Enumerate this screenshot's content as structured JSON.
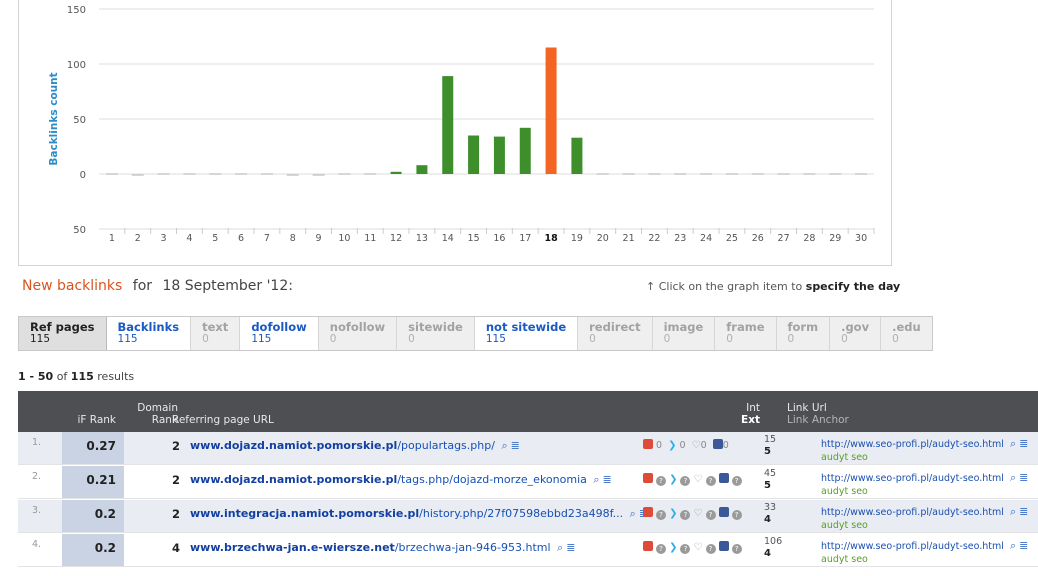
{
  "chart_data": {
    "type": "bar",
    "ylabel": "Backlinks count",
    "y_ticks": [
      "150",
      "100",
      "50",
      "0",
      "50"
    ],
    "categories": [
      "1",
      "2",
      "3",
      "4",
      "5",
      "6",
      "7",
      "8",
      "9",
      "10",
      "11",
      "12",
      "13",
      "14",
      "15",
      "16",
      "17",
      "18",
      "19",
      "20",
      "21",
      "22",
      "23",
      "24",
      "25",
      "26",
      "27",
      "28",
      "29",
      "30"
    ],
    "values": [
      0,
      -1,
      0,
      0,
      0,
      0,
      0,
      -1,
      -1,
      0,
      0,
      2,
      8,
      89,
      35,
      34,
      42,
      115,
      33,
      0,
      0,
      0,
      0,
      0,
      0,
      0,
      0,
      0,
      0,
      0
    ],
    "highlight_category": "18",
    "colors": {
      "default": "#3e8f2c",
      "highlight": "#f26522",
      "zero": "#c8c8c8"
    },
    "grid": true
  },
  "new_backlinks": {
    "link_label": "New backlinks",
    "for_label": "for",
    "date": "18 September '12:"
  },
  "hint": {
    "prefix": "↑ Click on the graph item to",
    "bold": "specify the day"
  },
  "tabs": [
    {
      "label": "Ref pages",
      "count": "115"
    },
    {
      "label": "Backlinks",
      "count": "115"
    },
    {
      "label": "text",
      "count": "0"
    },
    {
      "label": "dofollow",
      "count": "115"
    },
    {
      "label": "nofollow",
      "count": "0"
    },
    {
      "label": "sitewide",
      "count": "0"
    },
    {
      "label": "not sitewide",
      "count": "115"
    },
    {
      "label": "redirect",
      "count": "0"
    },
    {
      "label": "image",
      "count": "0"
    },
    {
      "label": "frame",
      "count": "0"
    },
    {
      "label": "form",
      "count": "0"
    },
    {
      "label": ".gov",
      "count": "0"
    },
    {
      "label": ".edu",
      "count": "0"
    }
  ],
  "results": {
    "range": "1 - 50",
    "of": "of",
    "total": "115",
    "suffix": "results"
  },
  "table": {
    "headers": {
      "rank": "iF Rank",
      "domain_rank_1": "Domain",
      "domain_rank_2": "Rank",
      "url": "Referring page URL",
      "int": "Int",
      "ext": "Ext",
      "link_url": "Link Url",
      "link_anchor": "Link Anchor"
    },
    "rows": [
      {
        "num": "1.",
        "rank": "0.27",
        "domain_rank": "2",
        "url_domain": "www.dojazd.namiot.pomorskie.pl",
        "url_path": "/populartags.php/",
        "social": {
          "g": "0",
          "t": "0",
          "l": "0",
          "f": "0"
        },
        "int": "15",
        "ext": "5",
        "link_url": "http://www.seo-profi.pl/audyt-seo.html",
        "anchor": "audyt seo"
      },
      {
        "num": "2.",
        "rank": "0.21",
        "domain_rank": "2",
        "url_domain": "www.dojazd.namiot.pomorskie.pl",
        "url_path": "/tags.php/dojazd-morze_ekonomia",
        "int": "45",
        "ext": "5",
        "link_url": "http://www.seo-profi.pl/audyt-seo.html",
        "anchor": "audyt seo"
      },
      {
        "num": "3.",
        "rank": "0.2",
        "domain_rank": "2",
        "url_domain": "www.integracja.namiot.pomorskie.pl",
        "url_path": "/history.php/27f07598ebbd23a498f...",
        "int": "33",
        "ext": "4",
        "link_url": "http://www.seo-profi.pl/audyt-seo.html",
        "anchor": "audyt seo"
      },
      {
        "num": "4.",
        "rank": "0.2",
        "domain_rank": "4",
        "url_domain": "www.brzechwa-jan.e-wiersze.net",
        "url_path": "/brzechwa-jan-946-953.html",
        "int": "106",
        "ext": "4",
        "link_url": "http://www.seo-profi.pl/audyt-seo.html",
        "anchor": "audyt seo"
      }
    ]
  }
}
